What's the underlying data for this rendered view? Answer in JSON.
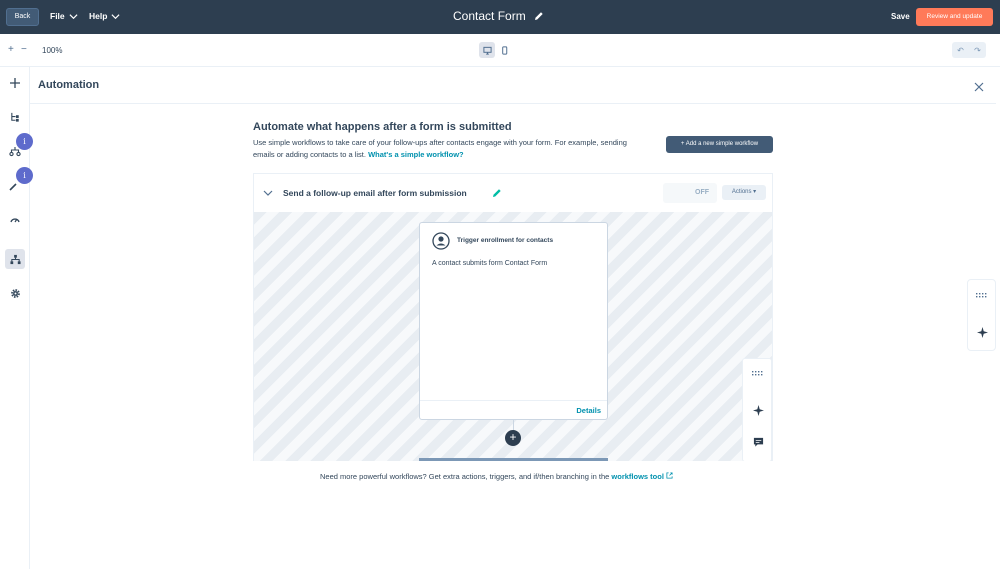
{
  "topbar": {
    "back_label": "Back",
    "file_label": "File",
    "help_label": "Help",
    "title": "Contact Form",
    "save_label": "Save",
    "review_label": "Review and update"
  },
  "toolbar": {
    "zoom_in": "+",
    "zoom_out": "−",
    "zoom_level": "100%",
    "undo": "↶",
    "redo": "↷"
  },
  "info_badges": [
    "i",
    "i"
  ],
  "panel": {
    "title": "Automation",
    "heading": "Automate what happens after a form is submitted",
    "description": "Use simple workflows to take care of your follow-ups after contacts engage with your form. For example, sending emails or adding contacts to a list.",
    "description_link": "What's a simple workflow?",
    "add_button": "+ Add a new simple workflow"
  },
  "workflow": {
    "title": "Send a follow-up email after form submission",
    "status": "OFF",
    "actions_label": "Actions ▾",
    "trigger": {
      "title": "Trigger enrollment for contacts",
      "body": "A contact submits form Contact Form",
      "details_label": "Details"
    },
    "add_step": "+"
  },
  "footnote": {
    "text": "Need more powerful workflows? Get extra actions, triggers, and if/then branching in the",
    "link": "workflows tool"
  },
  "colors": {
    "topbar": "#2d3e50",
    "accent": "#ff7a59",
    "link": "#0091ae",
    "info": "#5e6bcc"
  }
}
